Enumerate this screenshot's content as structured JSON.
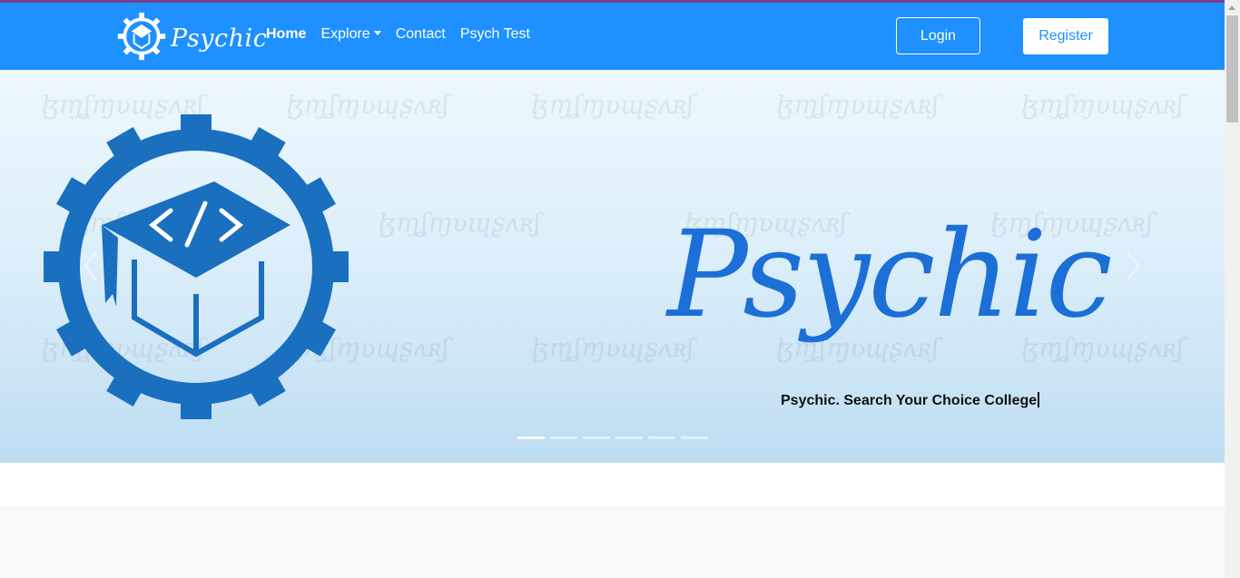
{
  "brand": {
    "name": "Psychic",
    "logo_icon": "gear-graduation-cap-icon"
  },
  "nav": {
    "items": [
      {
        "label": "Home",
        "active": true
      },
      {
        "label": "Explore",
        "dropdown": true
      },
      {
        "label": "Contact"
      },
      {
        "label": "Psych Test"
      }
    ]
  },
  "auth": {
    "login_label": "Login",
    "register_label": "Register"
  },
  "hero": {
    "title": "Psychic",
    "tagline": "Psychic. Search Your Choice College",
    "prev_icon": "chevron-left-icon",
    "next_icon": "chevron-right-icon",
    "slide_count": 6,
    "active_slide": 1
  },
  "colors": {
    "navbar": "#1e90ff",
    "logo_blue": "#1a6fbf",
    "title_blue": "#1c6fd6",
    "accent_top": "#7a3f8f"
  }
}
